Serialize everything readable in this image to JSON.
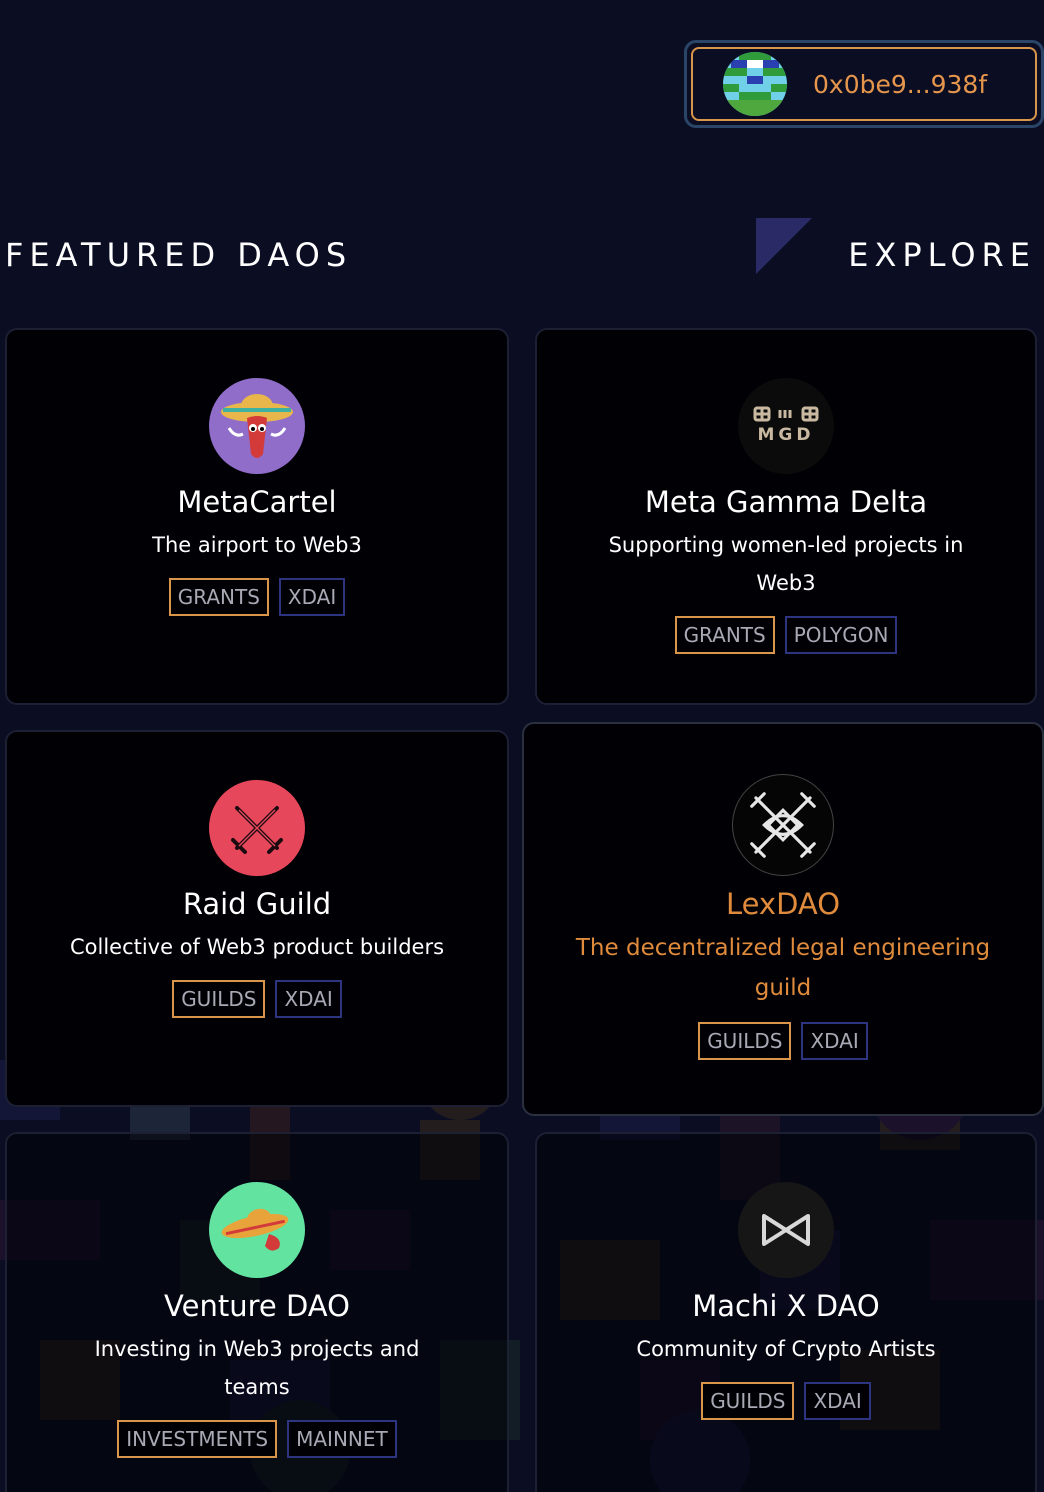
{
  "wallet": {
    "address": "0x0be9...938f"
  },
  "header": {
    "section_title": "FEATURED DAOS",
    "explore_label": "EXPLORE"
  },
  "colors": {
    "background": "#0b0e23",
    "card": "#000005",
    "accent_orange": "#e5954c",
    "tag_category_border": "#d9954a",
    "tag_network_border": "#2d3480"
  },
  "daos": [
    {
      "name": "MetaCartel",
      "description": "The airport to Web3",
      "tags": [
        "GRANTS",
        "XDAI"
      ],
      "logo": "chili-pepper-sombrero-icon"
    },
    {
      "name": "Meta Gamma Delta",
      "description": "Supporting women-led projects in Web3",
      "tags": [
        "GRANTS",
        "POLYGON"
      ],
      "logo": "mgd-logo-icon"
    },
    {
      "name": "Raid Guild",
      "description": "Collective of Web3 product builders",
      "tags": [
        "GUILDS",
        "XDAI"
      ],
      "logo": "crossed-swords-icon"
    },
    {
      "name": "LexDAO",
      "description": "The decentralized legal engineering guild",
      "tags": [
        "GUILDS",
        "XDAI"
      ],
      "logo": "knot-swords-icon"
    },
    {
      "name": "Venture DAO",
      "description": "Investing in Web3 projects and teams",
      "tags": [
        "INVESTMENTS",
        "MAINNET"
      ],
      "logo": "pepper-sombrero-icon"
    },
    {
      "name": "Machi X DAO",
      "description": "Community of Crypto Artists",
      "tags": [
        "GUILDS",
        "XDAI"
      ],
      "logo": "machi-x-icon"
    }
  ]
}
